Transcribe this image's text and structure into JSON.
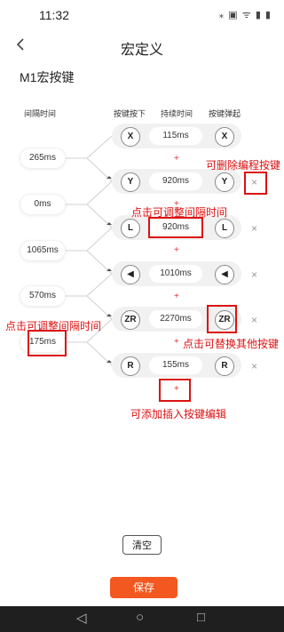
{
  "status": {
    "time": "11:32",
    "icons": "⁎ ▣ ᯤ ▮ ▮"
  },
  "header": {
    "title": "宏定义",
    "back_icon": "back-arrow"
  },
  "section_title": "M1宏按键",
  "columns": {
    "interval": "间隔时间",
    "press": "按键按下",
    "duration": "持续时间",
    "release": "按键弹起"
  },
  "intervals": [
    "265ms",
    "0ms",
    "1065ms",
    "570ms",
    "175ms"
  ],
  "rows": [
    {
      "press": "X",
      "duration": "115ms",
      "release": "X"
    },
    {
      "press": "Y",
      "duration": "920ms",
      "release": "Y"
    },
    {
      "press": "L",
      "duration": "920ms",
      "release": "L"
    },
    {
      "press": "◀",
      "duration": "1010ms",
      "release": "◀"
    },
    {
      "press": "ZR",
      "duration": "2270ms",
      "release": "ZR"
    },
    {
      "press": "R",
      "duration": "155ms",
      "release": "R"
    }
  ],
  "plus": "+",
  "delete": "×",
  "annotations": {
    "delete_hint": "可删除编程按键",
    "duration_hint": "点击可调整间隔时间",
    "interval_hint": "点击可调整间隔时间",
    "replace_hint": "点击可替换其他按键",
    "insert_hint": "可添加插入按键编辑"
  },
  "buttons": {
    "clear": "清空",
    "save": "保存"
  },
  "colors": {
    "accent": "#f2581f",
    "annotation": "#dd1111"
  },
  "nav": {
    "back": "◁",
    "home": "○",
    "recent": "□"
  }
}
